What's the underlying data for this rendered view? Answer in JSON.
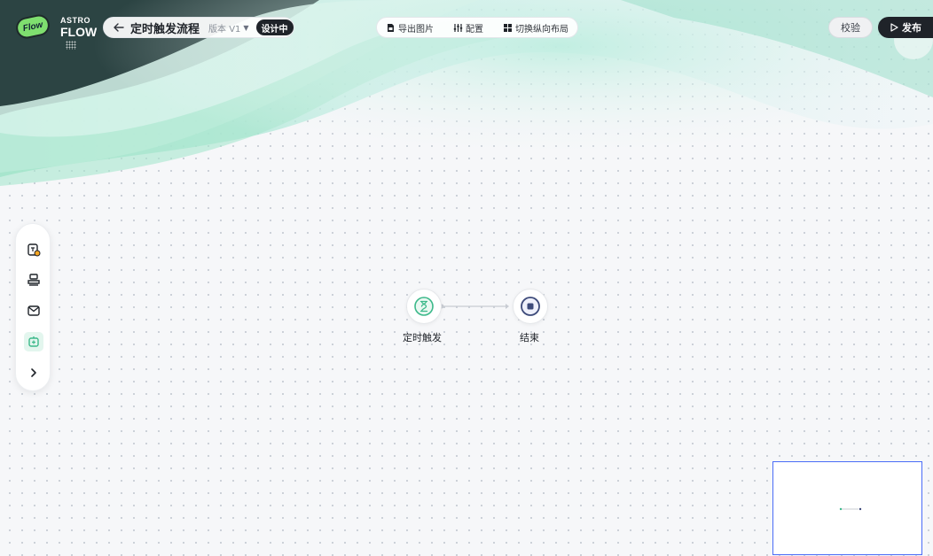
{
  "logo": {
    "badge": "Flow",
    "brand_top": "ASTRO",
    "brand_main": "FLOW"
  },
  "header": {
    "title": "定时触发流程",
    "version": "版本 V1",
    "status": "设计中"
  },
  "toolbar": {
    "export_image": "导出图片",
    "config": "配置",
    "switch_layout": "切换纵向布局"
  },
  "actions": {
    "verify": "校验",
    "publish": "发布"
  },
  "left_panel": {
    "items": [
      {
        "icon": "timer-trigger-icon"
      },
      {
        "icon": "stamp-icon"
      },
      {
        "icon": "mail-icon"
      },
      {
        "icon": "robot-icon",
        "active": true
      },
      {
        "icon": "chevron-right-icon"
      }
    ]
  },
  "nodes": {
    "trigger": {
      "label": "定时触发",
      "icon": "hourglass-icon"
    },
    "end": {
      "label": "结束",
      "icon": "stop-icon"
    }
  },
  "colors": {
    "accent": "#3cb98a",
    "primary_dark": "#1f2329",
    "minimap_border": "#4a6cf7"
  }
}
